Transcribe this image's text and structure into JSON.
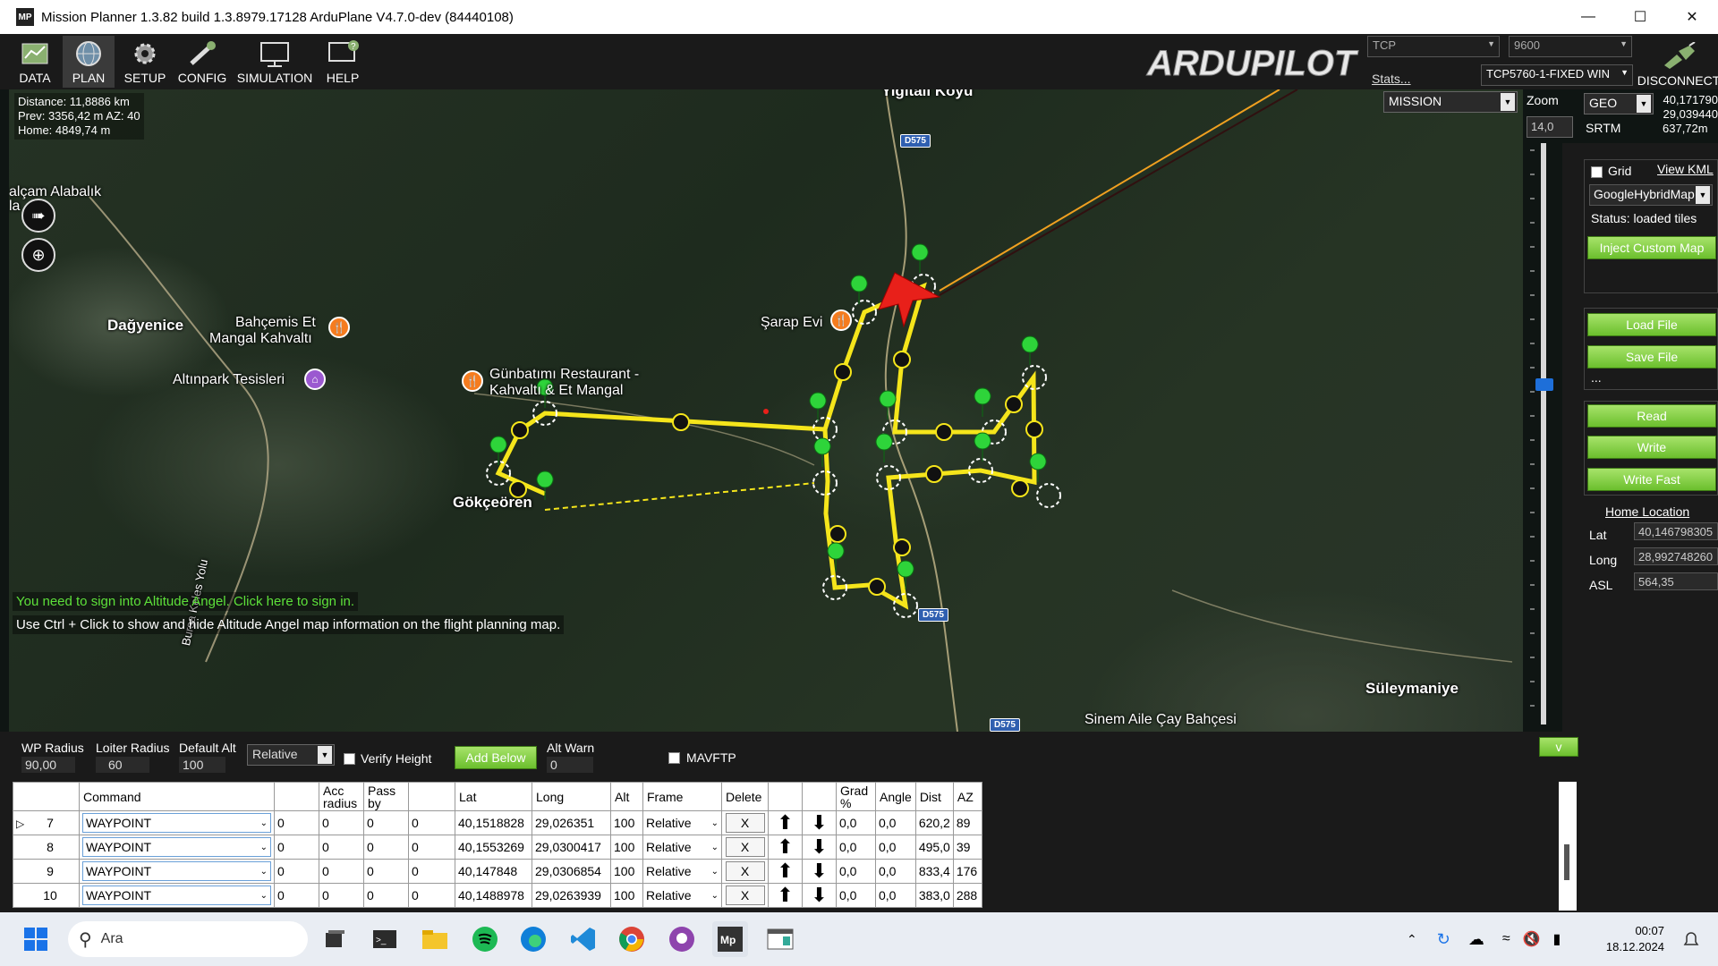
{
  "window": {
    "title": "Mission Planner 1.3.82 build 1.3.8979.17128 ArduPlane V4.7.0-dev (84440108)",
    "icon_label": "MP"
  },
  "toolbar": {
    "items": [
      {
        "label": "DATA"
      },
      {
        "label": "PLAN"
      },
      {
        "label": "SETUP"
      },
      {
        "label": "CONFIG"
      },
      {
        "label": "SIMULATION"
      },
      {
        "label": "HELP"
      }
    ],
    "logo_text": "ARDUPILOT",
    "protocol": "TCP",
    "baud": "9600",
    "stats_link": "Stats...",
    "device": "TCP5760-1-FIXED WIN",
    "disconnect_label": "DISCONNECT"
  },
  "map": {
    "info": {
      "distance": "Distance: 11,8886 km",
      "prev": "Prev: 3356,42 m AZ: 40",
      "home": "Home: 4849,74 m"
    },
    "labels": {
      "yigitali": "Yiğitali Köyü",
      "alcam": "alçam Alabalık",
      "alcam2": "la",
      "dagyenice": "Dağyenice",
      "bahcemis": "Bahçemis Et",
      "bahcemis2": "Mangal Kahvaltı",
      "altinpark": "Altınpark Tesisleri",
      "gunbatimi": "Günbatımı Restaurant -",
      "gunbatimi2": "Kahvaltı & Et Mangal",
      "sarap": "Şarap Evi",
      "gokceoren": "Gökçeören",
      "bursa_road": "Bursa Keles Yolu",
      "suleymaniye": "Süleymaniye",
      "sinem": "Sinem Aile Çay Bahçesi"
    },
    "road_badges": [
      "D575",
      "D575",
      "D575"
    ],
    "altitude_angel_signin": "You need to sign into Altitude Angel. Click here to sign in.",
    "altitude_angel_hint": "Use Ctrl + Click to show and hide Altitude Angel map information on the flight planning map."
  },
  "right_panel": {
    "mode_select": "MISSION",
    "zoom_label": "Zoom",
    "zoom_value": "14,0",
    "coord_system": "GEO",
    "lat_readout": "40,171790",
    "lng_readout": "29,039440",
    "alt_readout": "637,72m",
    "srtm_label": "SRTM",
    "grid_label": "Grid",
    "view_kml": "View KML",
    "map_type": "GoogleHybridMap",
    "status": "Status: loaded tiles",
    "inject_custom_map": "Inject Custom Map",
    "load_file": "Load File",
    "save_file": "Save File",
    "ellipsis": "...",
    "read": "Read",
    "write": "Write",
    "write_fast": "Write Fast",
    "home_location": "Home Location",
    "home_lat_label": "Lat",
    "home_lat": "40,146798305",
    "home_long_label": "Long",
    "home_long": "28,992748260",
    "home_asl_label": "ASL",
    "home_asl": "564,35"
  },
  "mission_params": {
    "wp_radius_label": "WP Radius",
    "wp_radius": "90,00",
    "loiter_radius_label": "Loiter Radius",
    "loiter_radius": "60",
    "default_alt_label": "Default Alt",
    "default_alt": "100",
    "alt_frame": "Relative",
    "verify_height": "Verify Height",
    "add_below": "Add Below",
    "alt_warn_label": "Alt Warn",
    "alt_warn": "0",
    "mavftp": "MAVFTP",
    "collapse": "v"
  },
  "waypoint_table": {
    "headers": [
      "",
      "Command",
      "",
      "Acc radius",
      "Pass by",
      "",
      "Lat",
      "Long",
      "Alt",
      "Frame",
      "Delete",
      "",
      "",
      "Grad %",
      "Angle",
      "Dist",
      "AZ"
    ],
    "rows": [
      {
        "marker": "▷",
        "num": "7",
        "cmd": "WAYPOINT",
        "p1": "0",
        "p2": "0",
        "p3": "0",
        "p4": "0",
        "lat": "40,1518828",
        "lng": "29,026351",
        "alt": "100",
        "frame": "Relative",
        "del": "X",
        "grad": "0,0",
        "angle": "0,0",
        "dist": "620,2",
        "az": "89"
      },
      {
        "marker": "",
        "num": "8",
        "cmd": "WAYPOINT",
        "p1": "0",
        "p2": "0",
        "p3": "0",
        "p4": "0",
        "lat": "40,1553269",
        "lng": "29,0300417",
        "alt": "100",
        "frame": "Relative",
        "del": "X",
        "grad": "0,0",
        "angle": "0,0",
        "dist": "495,0",
        "az": "39"
      },
      {
        "marker": "",
        "num": "9",
        "cmd": "WAYPOINT",
        "p1": "0",
        "p2": "0",
        "p3": "0",
        "p4": "0",
        "lat": "40,147848",
        "lng": "29,0306854",
        "alt": "100",
        "frame": "Relative",
        "del": "X",
        "grad": "0,0",
        "angle": "0,0",
        "dist": "833,4",
        "az": "176"
      },
      {
        "marker": "",
        "num": "10",
        "cmd": "WAYPOINT",
        "p1": "0",
        "p2": "0",
        "p3": "0",
        "p4": "0",
        "lat": "40,1488978",
        "lng": "29,0263939",
        "alt": "100",
        "frame": "Relative",
        "del": "X",
        "grad": "0,0",
        "angle": "0,0",
        "dist": "383,0",
        "az": "288"
      }
    ]
  },
  "taskbar": {
    "search_placeholder": "Ara",
    "time": "00:07",
    "date": "18.12.2024"
  },
  "colors": {
    "route": "#f5e51b",
    "waypoint_marker": "#2ed43a",
    "green_button": "#7ccb3a",
    "aircraft": "#e8201a",
    "zoom_thumb": "#1e6fd9"
  }
}
